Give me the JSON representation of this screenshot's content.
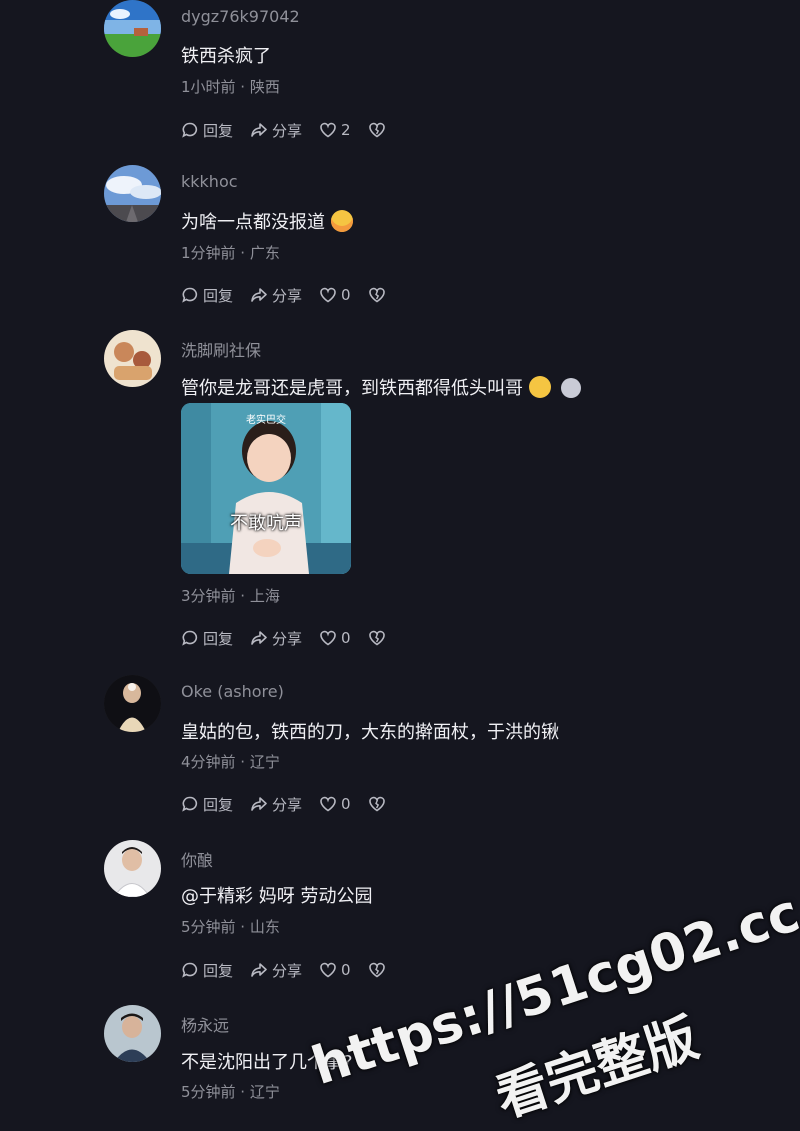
{
  "comments": [
    {
      "username": "dygz76k97042",
      "text": "铁西杀疯了",
      "meta": "1小时前 · 陕西",
      "reply_label": "回复",
      "share_label": "分享",
      "likes": "2"
    },
    {
      "username": "kkkhoc",
      "text": "为啥一点都没报道",
      "emoji": "scared-face-emoji",
      "meta": "1分钟前 · 广东",
      "reply_label": "回复",
      "share_label": "分享",
      "likes": "0"
    },
    {
      "username": "洗脚刷社保",
      "text": "管你是龙哥还是虎哥，到铁西都得低头叫哥",
      "emoji": [
        "smirk-face-emoji",
        "cat-emoji"
      ],
      "sticker": {
        "top_caption": "老实巴交",
        "main_caption": "不敢吭声"
      },
      "meta": "3分钟前 · 上海",
      "reply_label": "回复",
      "share_label": "分享",
      "likes": "0"
    },
    {
      "username": "Oke (ashore)",
      "text": "皇姑的包，铁西的刀，大东的擀面杖，于洪的锹",
      "meta": "4分钟前 · 辽宁",
      "reply_label": "回复",
      "share_label": "分享",
      "likes": "0"
    },
    {
      "username": "你酿",
      "text": "@于精彩  妈呀  劳动公园",
      "meta": "5分钟前 · 山东",
      "reply_label": "回复",
      "share_label": "分享",
      "likes": "0"
    },
    {
      "username": "杨永远",
      "text": "不是沈阳出了几个事?",
      "meta": "5分钟前 · 辽宁"
    }
  ],
  "watermark": {
    "url": "https://51cg02.cc",
    "subtitle": "看完整版"
  },
  "colors": {
    "background": "#15161f",
    "text": "#f0f0f4",
    "muted": "#8f9099"
  }
}
